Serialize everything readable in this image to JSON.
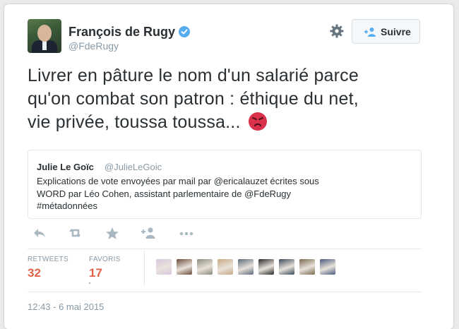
{
  "author": {
    "name": "François de Rugy",
    "handle": "@FdeRugy",
    "verified": true
  },
  "header": {
    "settings_icon": "gear-icon",
    "follow_label": "Suivre"
  },
  "tweet": {
    "line1": "Livrer en pâture le nom d'un salarié parce",
    "line2": "qu'on combat son patron :  éthique du net,",
    "line3": "vie privée, toussa toussa...",
    "emoji": "angry-face-icon"
  },
  "quoted": {
    "name": "Julie Le Goïc",
    "handle": "@JulieLeGoic",
    "line1": "Explications de vote envoyées par mail par @ericalauzet écrites sous",
    "line2": "WORD  par Léo Cohen, assistant parlementaire de @FdeRugy",
    "line3": "#métadonnées"
  },
  "actions": [
    "reply-icon",
    "retweet-icon",
    "favorite-icon",
    "follow-icon",
    "more-icon"
  ],
  "stats": {
    "retweets_label": "RETWEETS",
    "retweets_count": "32",
    "favorites_label": "FAVORIS",
    "favorites_count": "17"
  },
  "favoriters": [
    {
      "color": "#d9c7e0"
    },
    {
      "color": "#6a4a3a"
    },
    {
      "color": "#8a8a7a"
    },
    {
      "color": "#c9a882"
    },
    {
      "color": "#5a6a7a"
    },
    {
      "color": "#2a2a2a"
    },
    {
      "color": "#3a4a5a"
    },
    {
      "color": "#7a6a50"
    },
    {
      "color": "#4a5a80"
    }
  ],
  "timestamp": "12:43 - 6 mai 2015",
  "colors": {
    "accent": "#55acee",
    "count": "#e0624a",
    "text": "#292f33",
    "muted": "#8899a6"
  }
}
